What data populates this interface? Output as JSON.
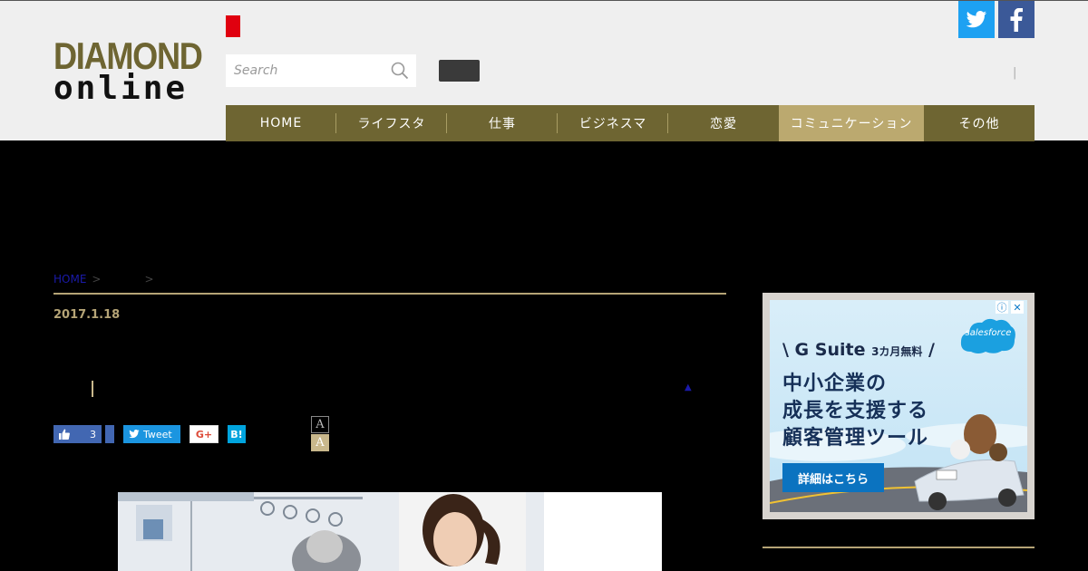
{
  "logo": {
    "line1": "DIAMOND",
    "line2": "online"
  },
  "search": {
    "placeholder": "Search"
  },
  "header": {
    "separator": "|"
  },
  "nav": {
    "items": [
      {
        "label": "HOME",
        "active": false
      },
      {
        "label": "ライフスタ",
        "active": false
      },
      {
        "label": "仕事",
        "active": false
      },
      {
        "label": "ビジネスマ",
        "active": false
      },
      {
        "label": "恋愛",
        "active": false
      },
      {
        "label": "コミュニケーション",
        "active": true
      },
      {
        "label": "その他",
        "active": false
      }
    ]
  },
  "breadcrumb": {
    "home": "HOME",
    "sep1": ">",
    "sep2": ">"
  },
  "article": {
    "date": "2017.1.18",
    "up_arrow": "▲"
  },
  "share": {
    "like_count": "3",
    "tweet_label": "Tweet",
    "gplus_label": "G+",
    "hatena_label": "B!",
    "font_small": "A",
    "font_large": "A"
  },
  "ad": {
    "line1_prefix": "\\ G Suite ",
    "line1_small": "3カ月無料",
    "line1_suffix": " /",
    "line2": "中小企業の",
    "line3": "成長を支援する",
    "line4": "顧客管理ツール",
    "cta": "詳細はこちら",
    "brand": "salesforce",
    "info": "ⓘ",
    "close": "✕"
  },
  "colors": {
    "brand": "#6e6532",
    "nav_active": "#bba96f",
    "accent_rule": "#b5a476",
    "twitter": "#1da1f2",
    "facebook": "#3b5998"
  }
}
